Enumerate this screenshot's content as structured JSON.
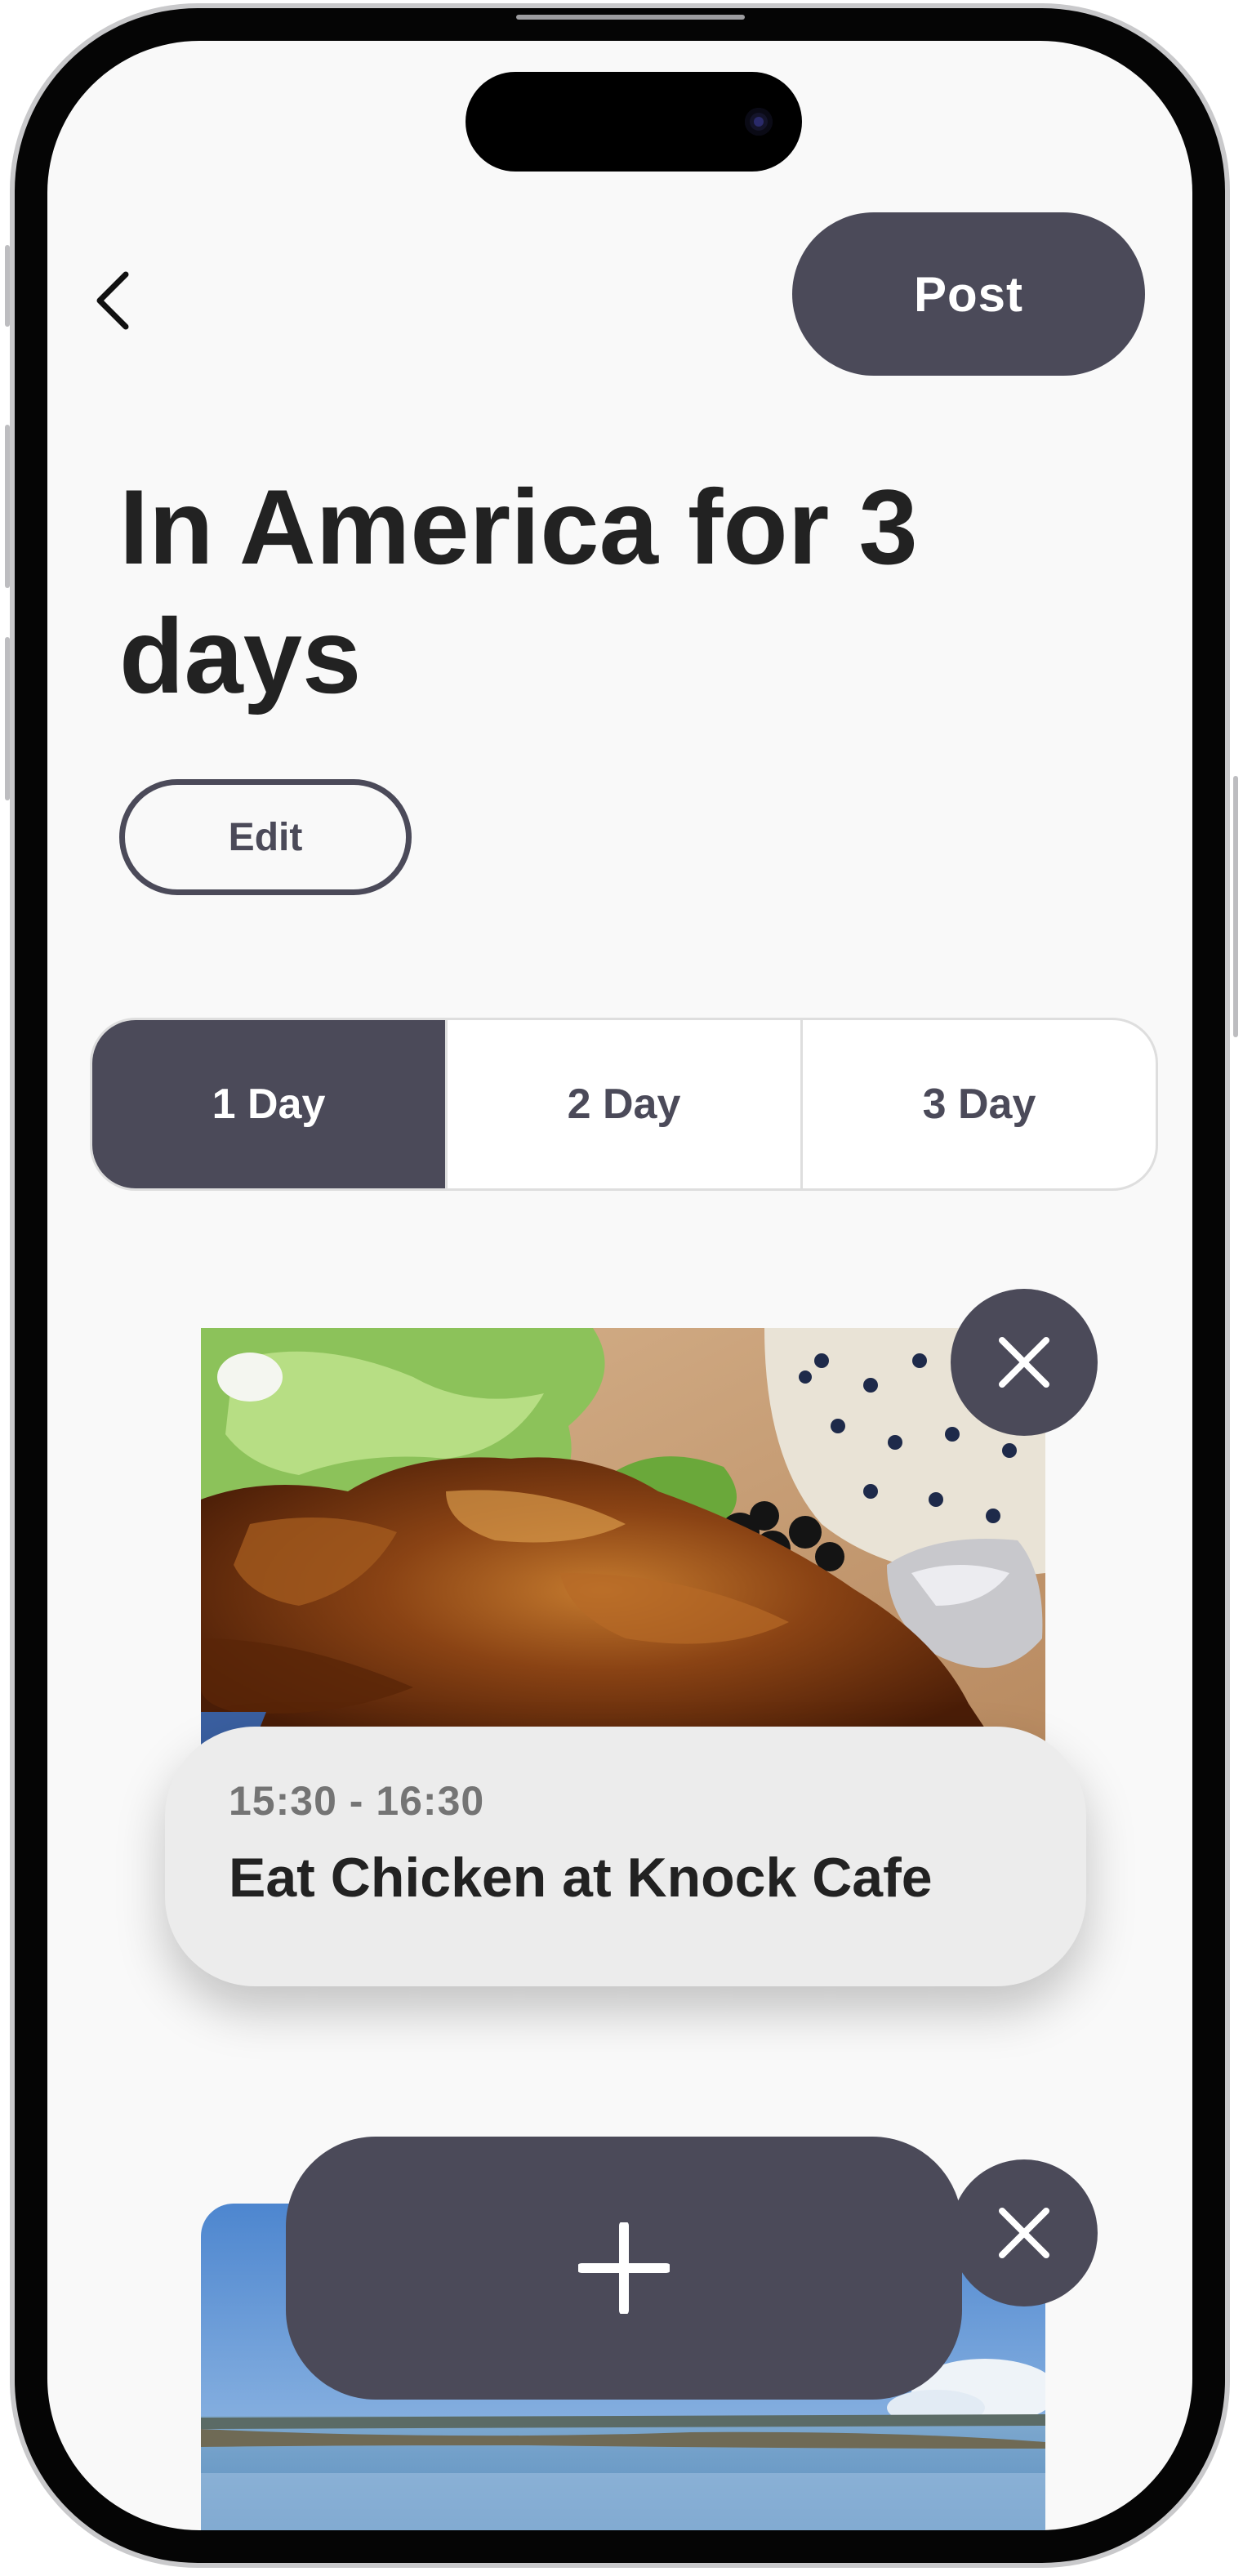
{
  "header": {
    "post_label": "Post"
  },
  "trip": {
    "title": "In America for 3 days",
    "edit_label": "Edit"
  },
  "tabs": [
    {
      "label": "1 Day",
      "active": true
    },
    {
      "label": "2 Day",
      "active": false
    },
    {
      "label": "3 Day",
      "active": false
    }
  ],
  "plans": [
    {
      "time": "15:30 - 16:30",
      "title": "Eat Chicken at Knock Cafe",
      "photo_icon": "roast-chicken-photo"
    },
    {
      "photo_icon": "seaside-photo"
    }
  ],
  "colors": {
    "accent": "#4b4a59",
    "background": "#f9f9f9",
    "card": "#ececec",
    "text": "#222222"
  }
}
